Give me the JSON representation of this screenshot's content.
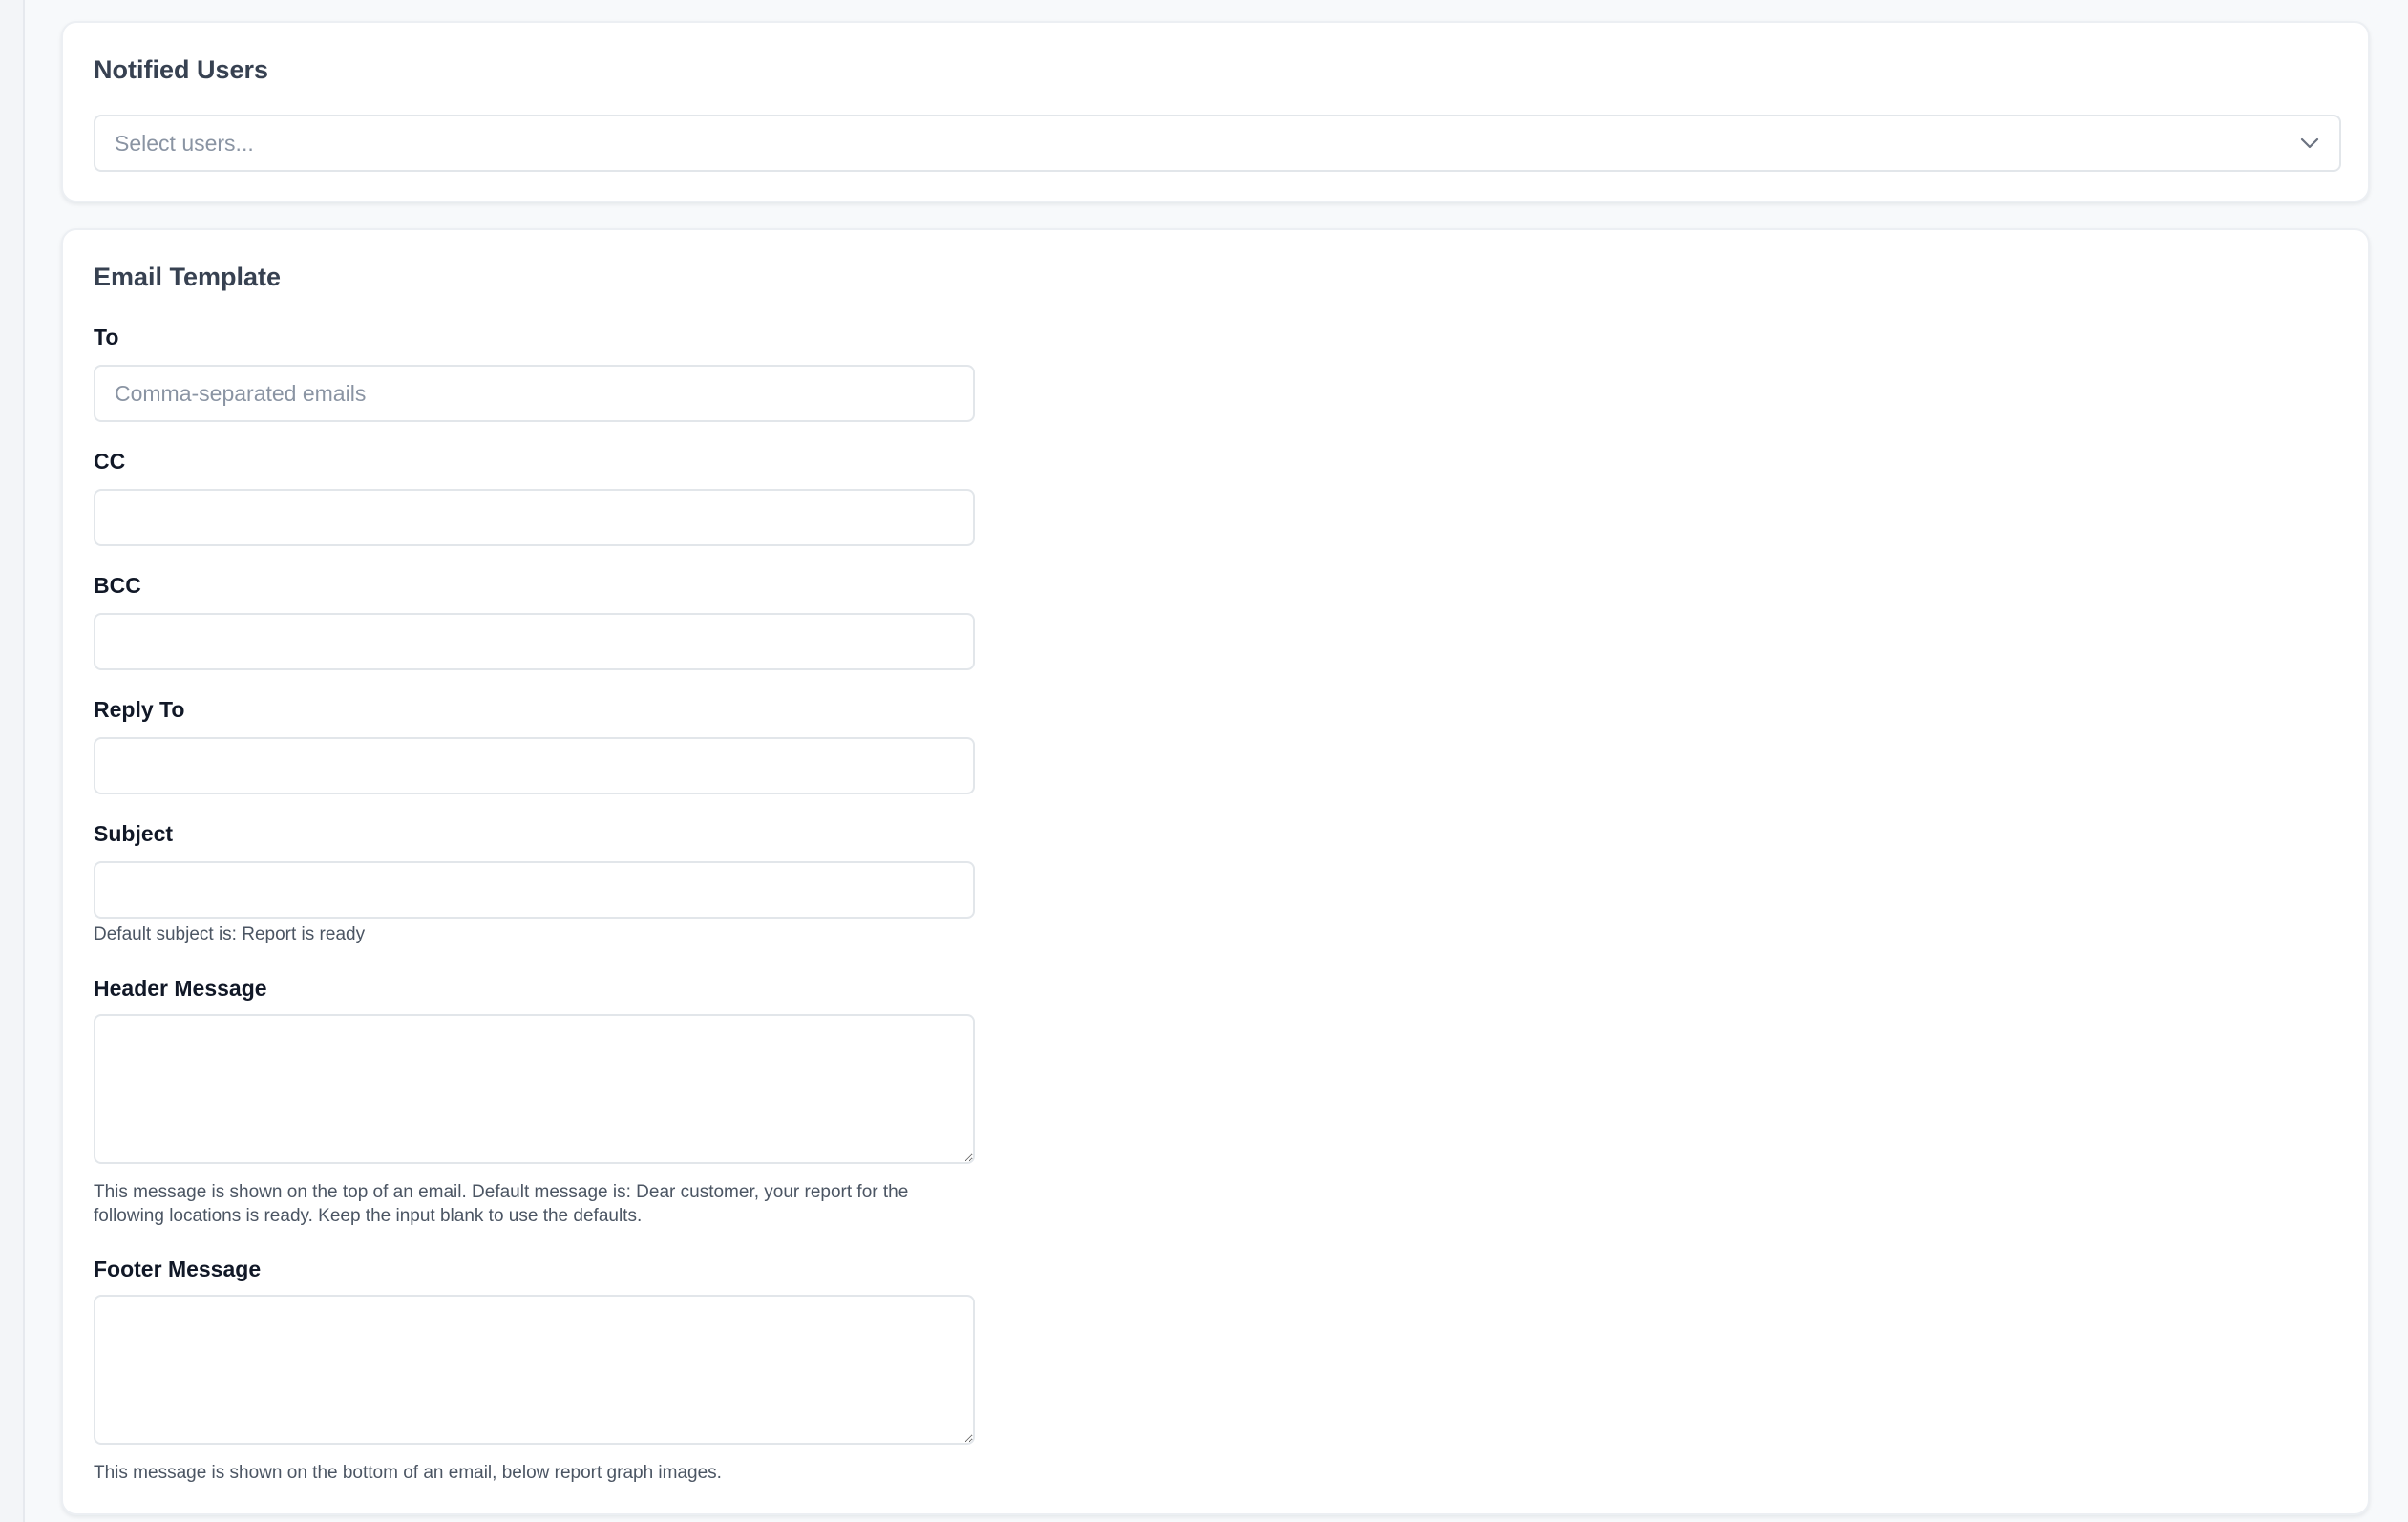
{
  "notified_users": {
    "title": "Notified Users",
    "select_placeholder": "Select users..."
  },
  "email_template": {
    "title": "Email Template",
    "to": {
      "label": "To",
      "placeholder": "Comma-separated emails",
      "value": ""
    },
    "cc": {
      "label": "CC",
      "value": ""
    },
    "bcc": {
      "label": "BCC",
      "value": ""
    },
    "reply_to": {
      "label": "Reply To",
      "value": ""
    },
    "subject": {
      "label": "Subject",
      "value": "",
      "help": "Default subject is: Report is ready"
    },
    "header_message": {
      "label": "Header Message",
      "value": "",
      "help": "This message is shown on the top of an email. Default message is: Dear customer, your report for the following locations is ready. Keep the input blank to use the defaults."
    },
    "footer_message": {
      "label": "Footer Message",
      "value": "",
      "help": "This message is shown on the bottom of an email, below report graph images."
    }
  },
  "icons": {
    "select_chevron": "chevron-down-icon",
    "textarea_resize": "resize-grip-icon"
  },
  "colors": {
    "page_background": "#f7f9fb",
    "card_background": "#ffffff",
    "border": "#e2e6ea",
    "title_text": "#374151",
    "label_text": "#111827",
    "help_text": "#4b5563",
    "placeholder_text": "#8a94a3"
  }
}
